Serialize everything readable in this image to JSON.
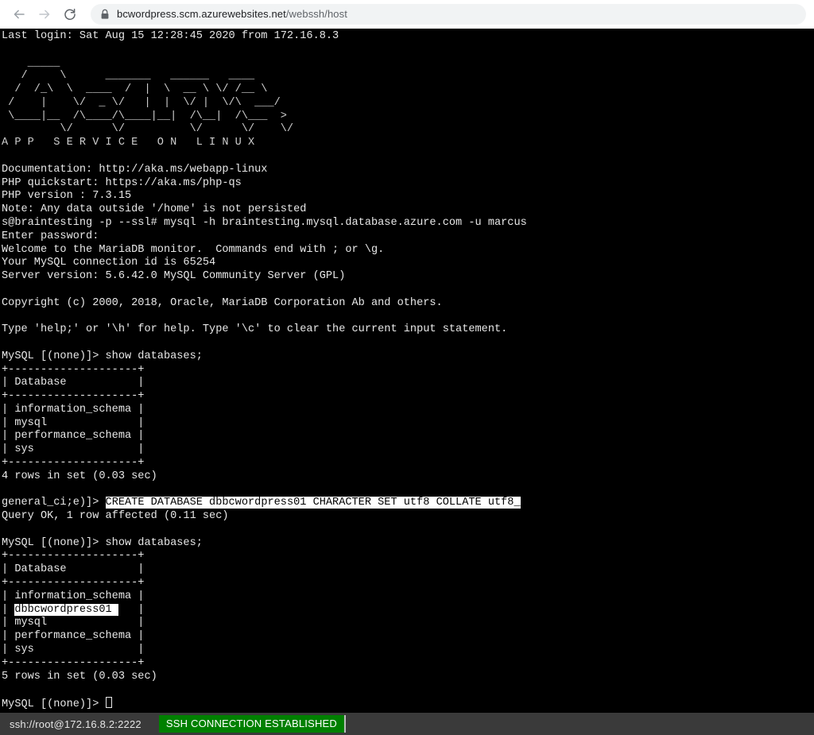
{
  "browser": {
    "back_icon": "arrow-left-icon",
    "forward_icon": "arrow-right-icon",
    "reload_icon": "reload-icon",
    "lock_icon": "lock-icon",
    "url_domain": "bcwordpress.scm.azurewebsites.net",
    "url_path": "/webssh/host",
    "url_full": "bcwordpress.scm.azurewebsites.net/webssh/host"
  },
  "terminal": {
    "lines": [
      {
        "text": "Last login: Sat Aug 15 12:28:45 2020 from 172.16.8.3"
      },
      {
        "text": ""
      },
      {
        "text": "    _____                                  ",
        "kind": "art"
      },
      {
        "text": "   /     \\      _______   ______   ____    ",
        "kind": "art"
      },
      {
        "text": "  /  /_\\  \\  ____  /  |  \\  __ \\ \\/ /__ \\  ",
        "kind": "art"
      },
      {
        "text": " /    |    \\/  _ \\/   |  |  \\/ |  \\/\\  ___/ ",
        "kind": "art"
      },
      {
        "text": " \\____|__  /\\____/\\____|__|  /\\__|  /\\___  >",
        "kind": "art"
      },
      {
        "text": "         \\/      \\/          \\/      \\/    \\/",
        "kind": "art"
      },
      {
        "text": "A P P   S E R V I C E   O N   L I N U X",
        "kind": "art"
      },
      {
        "text": ""
      },
      {
        "text": "Documentation: http://aka.ms/webapp-linux"
      },
      {
        "text": "PHP quickstart: https://aka.ms/php-qs"
      },
      {
        "text": "PHP version : 7.3.15"
      },
      {
        "text": "Note: Any data outside '/home' is not persisted"
      },
      {
        "text": "s@braintesting -p --ssl# mysql -h braintesting.mysql.database.azure.com -u marcus"
      },
      {
        "text": "Enter password:"
      },
      {
        "text": "Welcome to the MariaDB monitor.  Commands end with ; or \\g."
      },
      {
        "text": "Your MySQL connection id is 65254"
      },
      {
        "text": "Server version: 5.6.42.0 MySQL Community Server (GPL)"
      },
      {
        "text": ""
      },
      {
        "text": "Copyright (c) 2000, 2018, Oracle, MariaDB Corporation Ab and others."
      },
      {
        "text": ""
      },
      {
        "text": "Type 'help;' or '\\h' for help. Type '\\c' to clear the current input statement."
      },
      {
        "text": ""
      },
      {
        "text": "MySQL [(none)]> show databases;"
      },
      {
        "text": "+--------------------+"
      },
      {
        "text": "| Database           |"
      },
      {
        "text": "+--------------------+"
      },
      {
        "text": "| information_schema |"
      },
      {
        "text": "| mysql              |"
      },
      {
        "text": "| performance_schema |"
      },
      {
        "text": "| sys                |"
      },
      {
        "text": "+--------------------+"
      },
      {
        "text": "4 rows in set (0.03 sec)"
      },
      {
        "text": ""
      },
      {
        "text": "general_ci;e)]> ",
        "highlight_after": "CREATE DATABASE dbbcwordpress01 CHARACTER SET utf8 COLLATE utf8_"
      },
      {
        "text": "Query OK, 1 row affected (0.11 sec)"
      },
      {
        "text": ""
      },
      {
        "text": "MySQL [(none)]> show databases;"
      },
      {
        "text": "+--------------------+"
      },
      {
        "text": "| Database           |"
      },
      {
        "text": "+--------------------+"
      },
      {
        "text": "| information_schema |"
      },
      {
        "text": "| ",
        "highlight_mid": "dbbcwordpress01 ",
        "tail": "   |"
      },
      {
        "text": "| mysql              |"
      },
      {
        "text": "| performance_schema |"
      },
      {
        "text": "| sys                |"
      },
      {
        "text": "+--------------------+"
      },
      {
        "text": "5 rows in set (0.03 sec)"
      },
      {
        "text": ""
      },
      {
        "text": "MySQL [(none)]> ",
        "cursor": true
      }
    ]
  },
  "status": {
    "host": "ssh://root@172.16.8.2:2222",
    "connection_state": "SSH CONNECTION ESTABLISHED",
    "badge_color": "#008000"
  }
}
